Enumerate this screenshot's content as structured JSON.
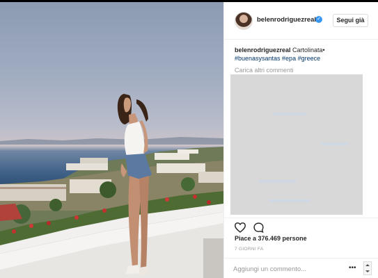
{
  "post": {
    "username": "belenrodriguezreal",
    "follow_label": "Segui già",
    "caption_user": "belenrodriguezreal",
    "caption_text": " Cartolinata•",
    "hashtags": "#buenasysantas #epa #greece",
    "load_more_label": "Carica altri commenti",
    "likes_text": "Piace a 376.469 persone",
    "timestamp": "7 GIORNI FA",
    "add_comment_placeholder": "Aggiungi un commento..."
  },
  "colors": {
    "link": "#003569",
    "verified": "#3897f0",
    "muted": "#999999",
    "text": "#262626"
  },
  "icons": {
    "verified": "verified-badge-icon",
    "like": "heart-icon",
    "comment": "comment-bubble-icon",
    "more": "more-options-icon"
  }
}
